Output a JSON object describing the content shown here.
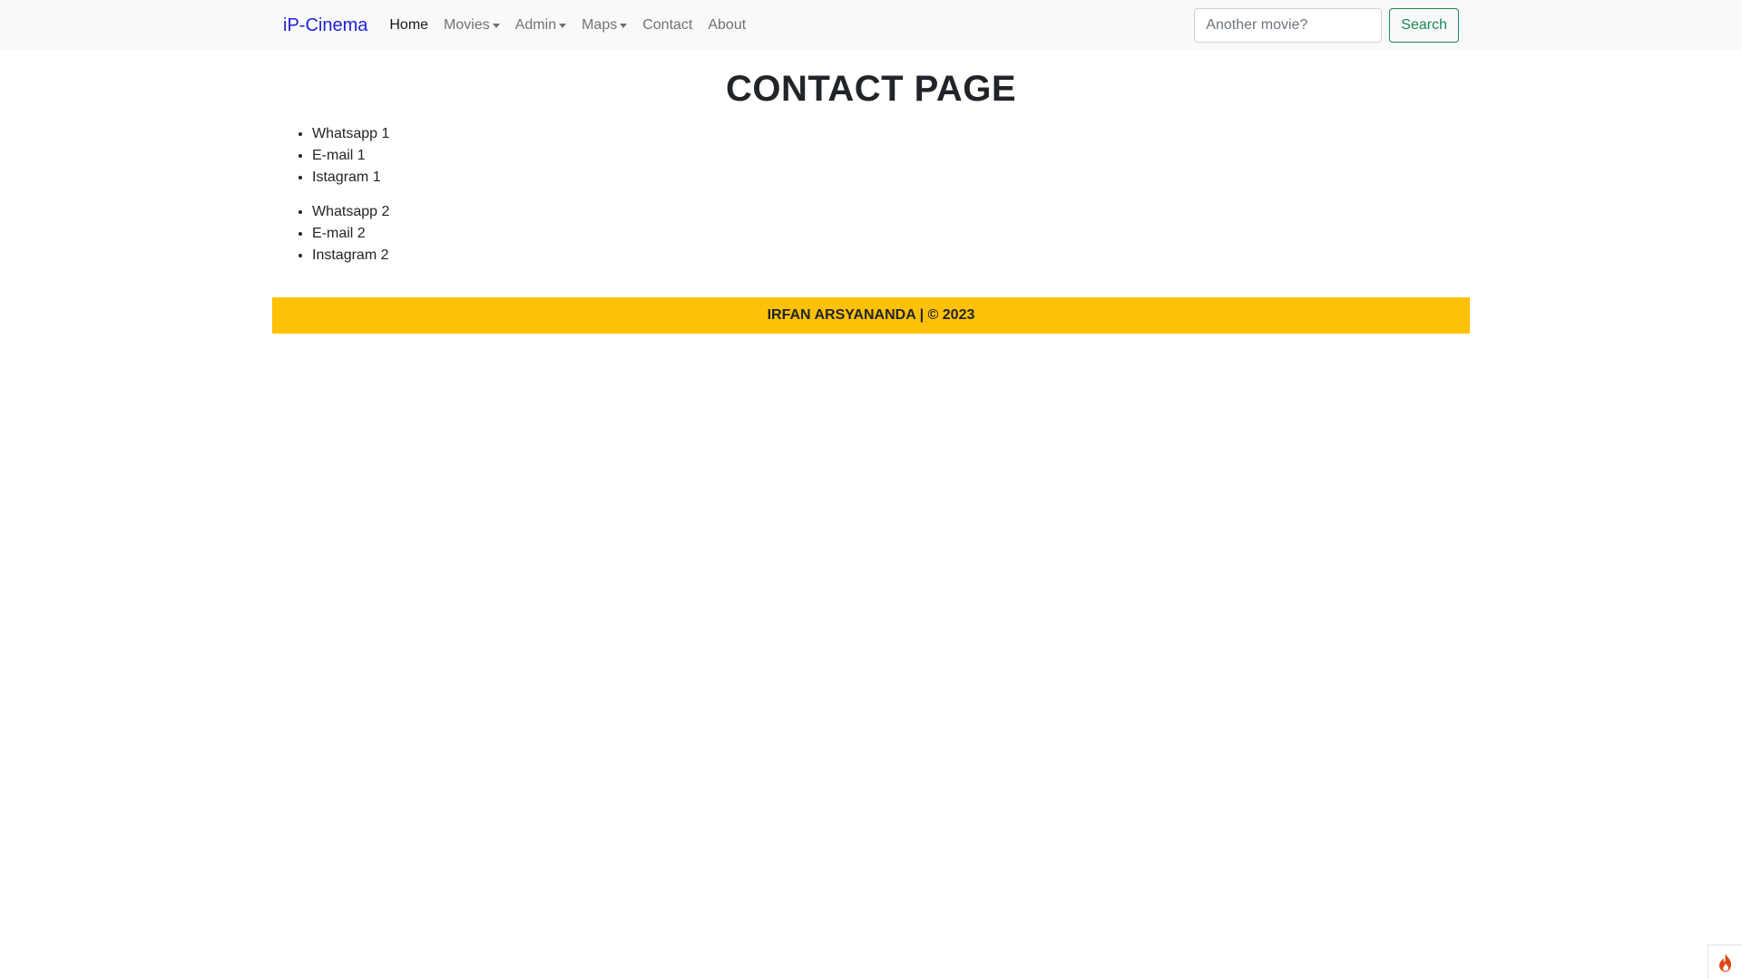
{
  "navbar": {
    "brand": "iP-Cinema",
    "brand_color": "#1f1fd6",
    "links": [
      {
        "label": "Home",
        "active": true,
        "dropdown": false
      },
      {
        "label": "Movies",
        "active": false,
        "dropdown": true
      },
      {
        "label": "Admin",
        "active": false,
        "dropdown": true
      },
      {
        "label": "Maps",
        "active": false,
        "dropdown": true
      },
      {
        "label": "Contact",
        "active": false,
        "dropdown": false
      },
      {
        "label": "About",
        "active": false,
        "dropdown": false
      }
    ],
    "search": {
      "placeholder": "Another movie?",
      "value": "",
      "button_label": "Search"
    }
  },
  "main": {
    "title": "CONTACT PAGE",
    "lists": [
      [
        "Whatsapp 1",
        "E-mail 1",
        "Istagram 1"
      ],
      [
        "Whatsapp 2",
        "E-mail 2",
        "Instagram 2"
      ]
    ]
  },
  "footer": {
    "text": "IRFAN ARSYANANDA | © 2023",
    "background": "#ffc107"
  },
  "corner_widget": {
    "icon": "flame-icon"
  }
}
